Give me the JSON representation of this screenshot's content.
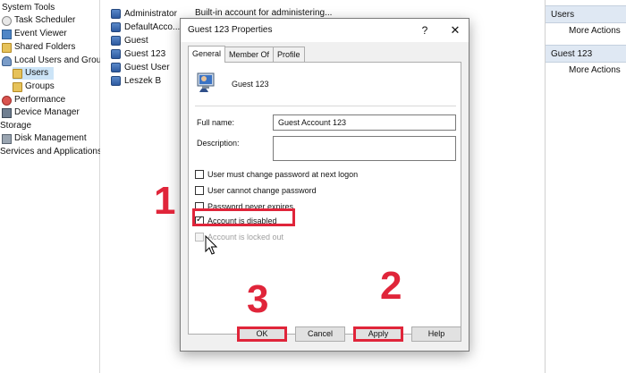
{
  "tree": {
    "items": [
      {
        "label": "System Tools",
        "icon": "none"
      },
      {
        "label": "Task Scheduler",
        "icon": "task-scheduler-icon"
      },
      {
        "label": "Event Viewer",
        "icon": "event-viewer-icon"
      },
      {
        "label": "Shared Folders",
        "icon": "shared-folders-icon"
      },
      {
        "label": "Local Users and Groups",
        "icon": "local-users-icon"
      },
      {
        "label": "Users",
        "icon": "folder-icon"
      },
      {
        "label": "Groups",
        "icon": "folder-icon"
      },
      {
        "label": "Performance",
        "icon": "performance-icon"
      },
      {
        "label": "Device Manager",
        "icon": "device-manager-icon"
      },
      {
        "label": "Storage",
        "icon": "none"
      },
      {
        "label": "Disk Management",
        "icon": "disk-management-icon"
      },
      {
        "label": "Services and Applications",
        "icon": "none"
      }
    ]
  },
  "users": {
    "rows": [
      "Administrator",
      "DefaultAcco...",
      "Guest",
      "Guest 123",
      "Guest User",
      "Leszek B"
    ],
    "admin_description": "Built-in account for administering..."
  },
  "actions": {
    "section1_title": "Users",
    "section1_item": "More Actions",
    "section2_title": "Guest 123",
    "section2_item": "More Actions"
  },
  "dialog": {
    "title": "Guest 123 Properties",
    "help_glyph": "?",
    "close_glyph": "✕",
    "tabs": [
      "General",
      "Member Of",
      "Profile"
    ],
    "user_name": "Guest 123",
    "full_name_label": "Full name:",
    "full_name_value": "Guest Account 123",
    "description_label": "Description:",
    "description_value": "",
    "checkboxes": [
      {
        "label": "User must change password at next logon",
        "checked": false,
        "enabled": true
      },
      {
        "label": "User cannot change password",
        "checked": false,
        "enabled": true
      },
      {
        "label": "Password never expires",
        "checked": false,
        "enabled": true
      },
      {
        "label": "Account is disabled",
        "checked": true,
        "enabled": true
      },
      {
        "label": "Account is locked out",
        "checked": false,
        "enabled": false
      }
    ],
    "buttons": {
      "ok": "OK",
      "cancel": "Cancel",
      "apply": "Apply",
      "help": "Help"
    }
  },
  "steps": {
    "one": "1",
    "two": "2",
    "three": "3"
  },
  "colors": {
    "highlight": "#e0253a",
    "selection": "#cce4f7",
    "actions_header": "#dfe8f3"
  }
}
